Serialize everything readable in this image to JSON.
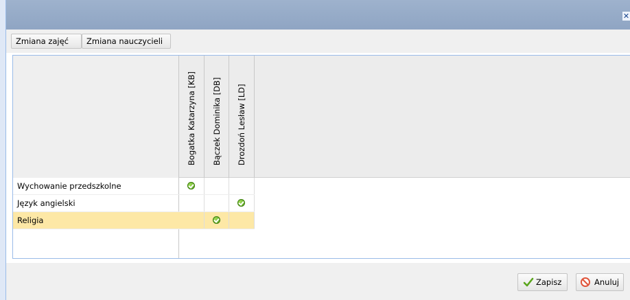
{
  "window": {
    "close_glyph": "✕"
  },
  "toolbar": {
    "btn_zajec": "Zmiana zajęć",
    "btn_nauczycieli": "Zmiana nauczycieli"
  },
  "grid": {
    "columns": [
      "Bogatka Katarzyna [KB]",
      "Bączek Dominika [DB]",
      "Drozdoń Lesław [LD]"
    ],
    "rows": [
      {
        "name": "Wychowanie przedszkolne",
        "checks": [
          true,
          false,
          false
        ],
        "selected": false
      },
      {
        "name": "Język angielski",
        "checks": [
          false,
          false,
          true
        ],
        "selected": false
      },
      {
        "name": "Religia",
        "checks": [
          false,
          true,
          false
        ],
        "selected": true
      }
    ]
  },
  "footer": {
    "save": "Zapisz",
    "cancel": "Anuluj"
  },
  "colors": {
    "selected_row": "#fde8a6",
    "titlebar": "#9eb2cd",
    "check": "#5aa51c",
    "cancel": "#e0543a"
  },
  "icons": {
    "check": "check-circle-icon",
    "save": "checkmark-icon",
    "cancel": "cancel-icon",
    "close": "close-icon"
  }
}
